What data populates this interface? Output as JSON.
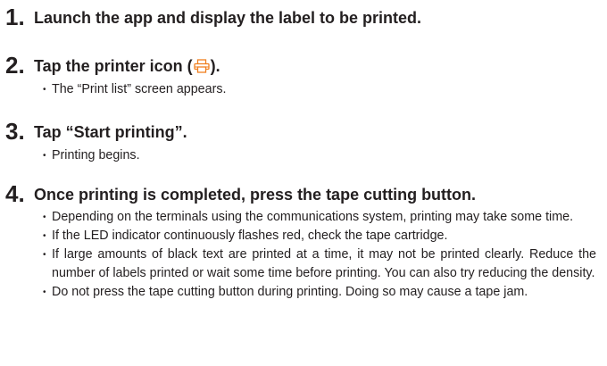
{
  "colors": {
    "text": "#231f20",
    "icon_accent": "#f07f1f"
  },
  "steps": [
    {
      "number": "1.",
      "title": "Launch the app and display the label to be printed.",
      "bullets": []
    },
    {
      "number": "2.",
      "title_before_icon": "Tap the printer icon (",
      "icon": "printer-icon",
      "title_after_icon": ").",
      "bullets": [
        "The “Print list” screen appears."
      ]
    },
    {
      "number": "3.",
      "title": "Tap “Start printing”.",
      "bullets": [
        "Printing begins."
      ]
    },
    {
      "number": "4.",
      "title": "Once printing is completed, press the tape cutting button.",
      "bullets": [
        "Depending on the terminals using the communications system, printing may take some time.",
        "If the LED indicator continuously flashes red, check the tape cartridge.",
        "If large amounts of black text are printed at a time, it may not be printed clearly. Reduce the number of labels printed or wait some time before printing. You can also try reducing the density.",
        "Do not press the tape cutting button during printing. Doing so may cause a tape jam."
      ]
    }
  ]
}
